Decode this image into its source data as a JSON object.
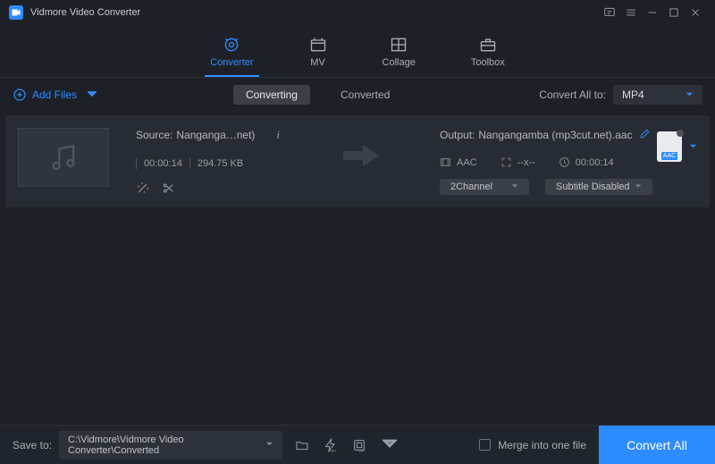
{
  "app": {
    "title": "Vidmore Video Converter"
  },
  "tabs": {
    "converter": "Converter",
    "mv": "MV",
    "collage": "Collage",
    "toolbox": "Toolbox"
  },
  "subbar": {
    "add_files": "Add Files",
    "converting": "Converting",
    "converted": "Converted",
    "convert_all_to": "Convert All to:",
    "format": "MP4"
  },
  "item": {
    "source_prefix": "Source: ",
    "source_name": "Nanganga…net)",
    "duration": "00:00:14",
    "size": "294.75 KB",
    "arrow_alt": "to",
    "output_prefix": "Output: ",
    "output_name": "Nangangamba (mp3cut.net).aac",
    "codec": "AAC",
    "resolution": "--x--",
    "out_duration": "00:00:14",
    "channel": "2Channel",
    "subtitle": "Subtitle Disabled",
    "format_tag": "AAC"
  },
  "bottom": {
    "save_to": "Save to:",
    "path": "C:\\Vidmore\\Vidmore Video Converter\\Converted",
    "merge": "Merge into one file",
    "convert_all": "Convert All"
  }
}
